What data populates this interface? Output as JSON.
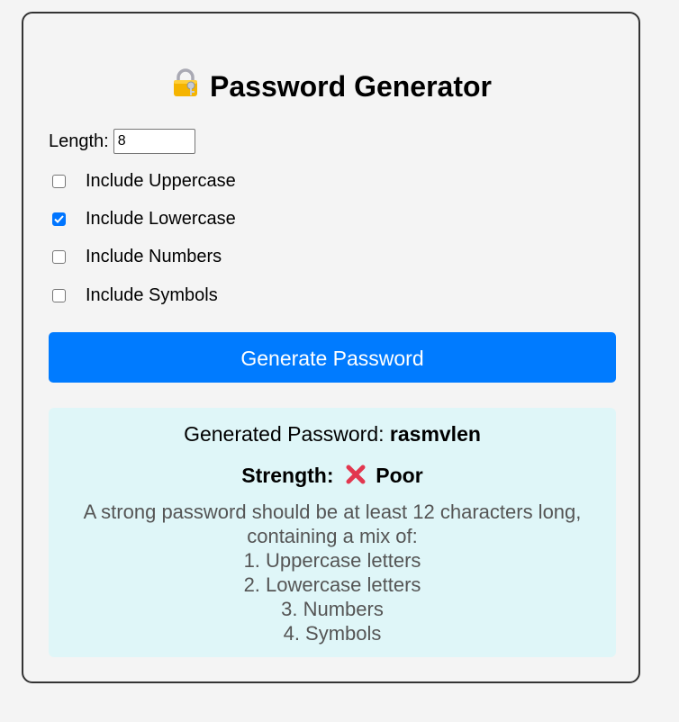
{
  "app": {
    "title": "Password Generator",
    "title_icon": "lock-with-key-icon"
  },
  "form": {
    "length_label": "Length:",
    "length_value": "8",
    "options": [
      {
        "label": "Include Uppercase",
        "checked": false
      },
      {
        "label": "Include Lowercase",
        "checked": true
      },
      {
        "label": "Include Numbers",
        "checked": false
      },
      {
        "label": "Include Symbols",
        "checked": false
      }
    ],
    "generate_label": "Generate Password"
  },
  "result": {
    "password_label": "Generated Password:",
    "password_value": "rasmvlen",
    "strength_label": "Strength:",
    "strength_icon": "cross-mark-icon",
    "strength_value": "Poor",
    "advice_intro": "A strong password should be at least 12 characters long, containing a mix of:",
    "advice_items": [
      "1. Uppercase letters",
      "2. Lowercase letters",
      "3. Numbers",
      "4. Symbols"
    ]
  },
  "colors": {
    "accent": "#007bff",
    "result_bg": "#dff6f8",
    "cross": "#e2374f"
  }
}
